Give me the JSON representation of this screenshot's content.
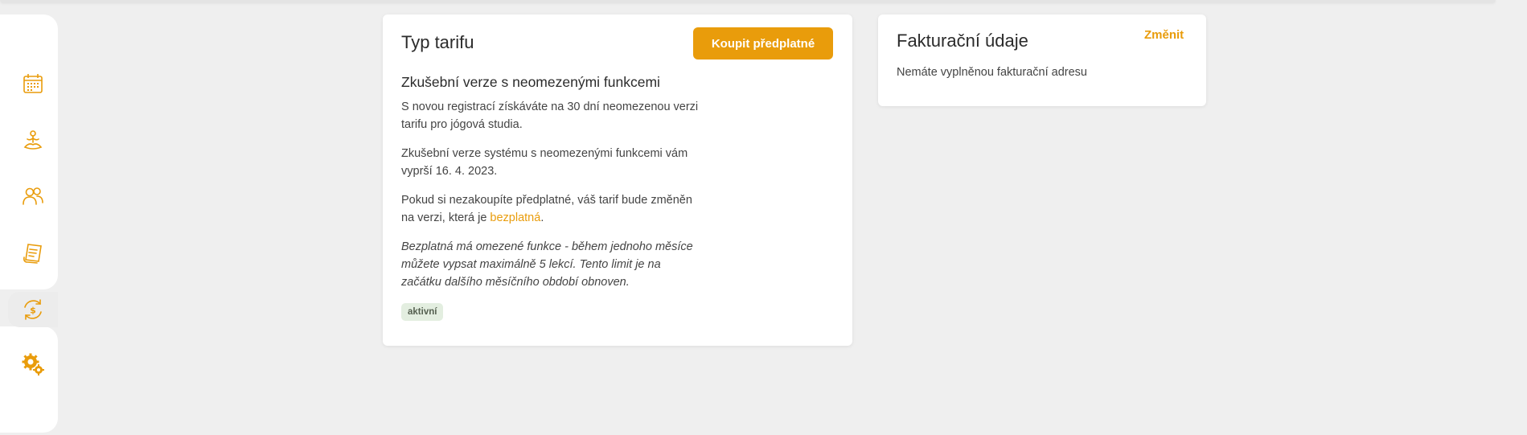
{
  "colors": {
    "accent": "#e99c0b",
    "badge_bg": "#e3eee0",
    "page_bg": "#efefef"
  },
  "sidebar": {
    "items": [
      {
        "icon": "calendar-icon"
      },
      {
        "icon": "yoga-icon"
      },
      {
        "icon": "users-icon"
      },
      {
        "icon": "receipt-icon"
      },
      {
        "icon": "billing-refresh-icon",
        "active": true
      },
      {
        "icon": "settings-gears-icon"
      }
    ]
  },
  "tariff": {
    "title": "Typ tarifu",
    "buy_button": "Koupit předplatné",
    "plan_name": "Zkušební verze s neomezenými funkcemi",
    "p1": "S novou registrací získáváte na 30 dní neomezenou verzi tarifu pro jógová studia.",
    "p2": "Zkušební verze systému s neomezenými funkcemi vám vyprší 16. 4. 2023.",
    "p3_before": "Pokud si nezakoupíte předplatné, váš tarif bude změněn na verzi, která je ",
    "p3_link": "bezplatná",
    "p3_after": ".",
    "p4": "Bezplatná má omezené funkce - během jednoho měsíce můžete vypsat maximálně 5 lekcí. Tento limit je na začátku dalšího měsíčního období obnoven.",
    "status_badge": "aktivní"
  },
  "billing": {
    "title": "Fakturační údaje",
    "change_link": "Změnit",
    "empty_text": "Nemáte vyplněnou fakturační adresu"
  }
}
